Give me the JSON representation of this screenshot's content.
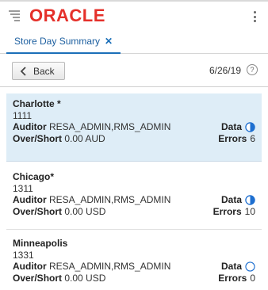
{
  "header": {
    "logo_text": "ORACLE"
  },
  "tabs": [
    {
      "label": "Store Day Summary",
      "close_glyph": "✕"
    }
  ],
  "toolbar": {
    "back_label": "Back",
    "date": "6/26/19",
    "help_glyph": "?"
  },
  "stores": [
    {
      "name": "Charlotte *",
      "number": "1111",
      "auditor_label": "Auditor",
      "auditor": "RESA_ADMIN,RMS_ADMIN",
      "overshort_label": "Over/Short",
      "overshort": "0.00 AUD",
      "data_label": "Data",
      "data_status": "half-filled",
      "errors_label": "Errors",
      "errors": "6",
      "selected": true
    },
    {
      "name": "Chicago*",
      "number": "1311",
      "auditor_label": "Auditor",
      "auditor": "RESA_ADMIN,RMS_ADMIN",
      "overshort_label": "Over/Short",
      "overshort": "0.00 USD",
      "data_label": "Data",
      "data_status": "half-filled",
      "errors_label": "Errors",
      "errors": "10",
      "selected": false
    },
    {
      "name": "Minneapolis",
      "number": "1331",
      "auditor_label": "Auditor",
      "auditor": "RESA_ADMIN,RMS_ADMIN",
      "overshort_label": "Over/Short",
      "overshort": "0.00 USD",
      "data_label": "Data",
      "data_status": "empty",
      "errors_label": "Errors",
      "errors": "0",
      "selected": false
    }
  ],
  "colors": {
    "brand": "#e5302a",
    "accent": "#1b6fb8",
    "selected_bg": "#deedf7"
  }
}
